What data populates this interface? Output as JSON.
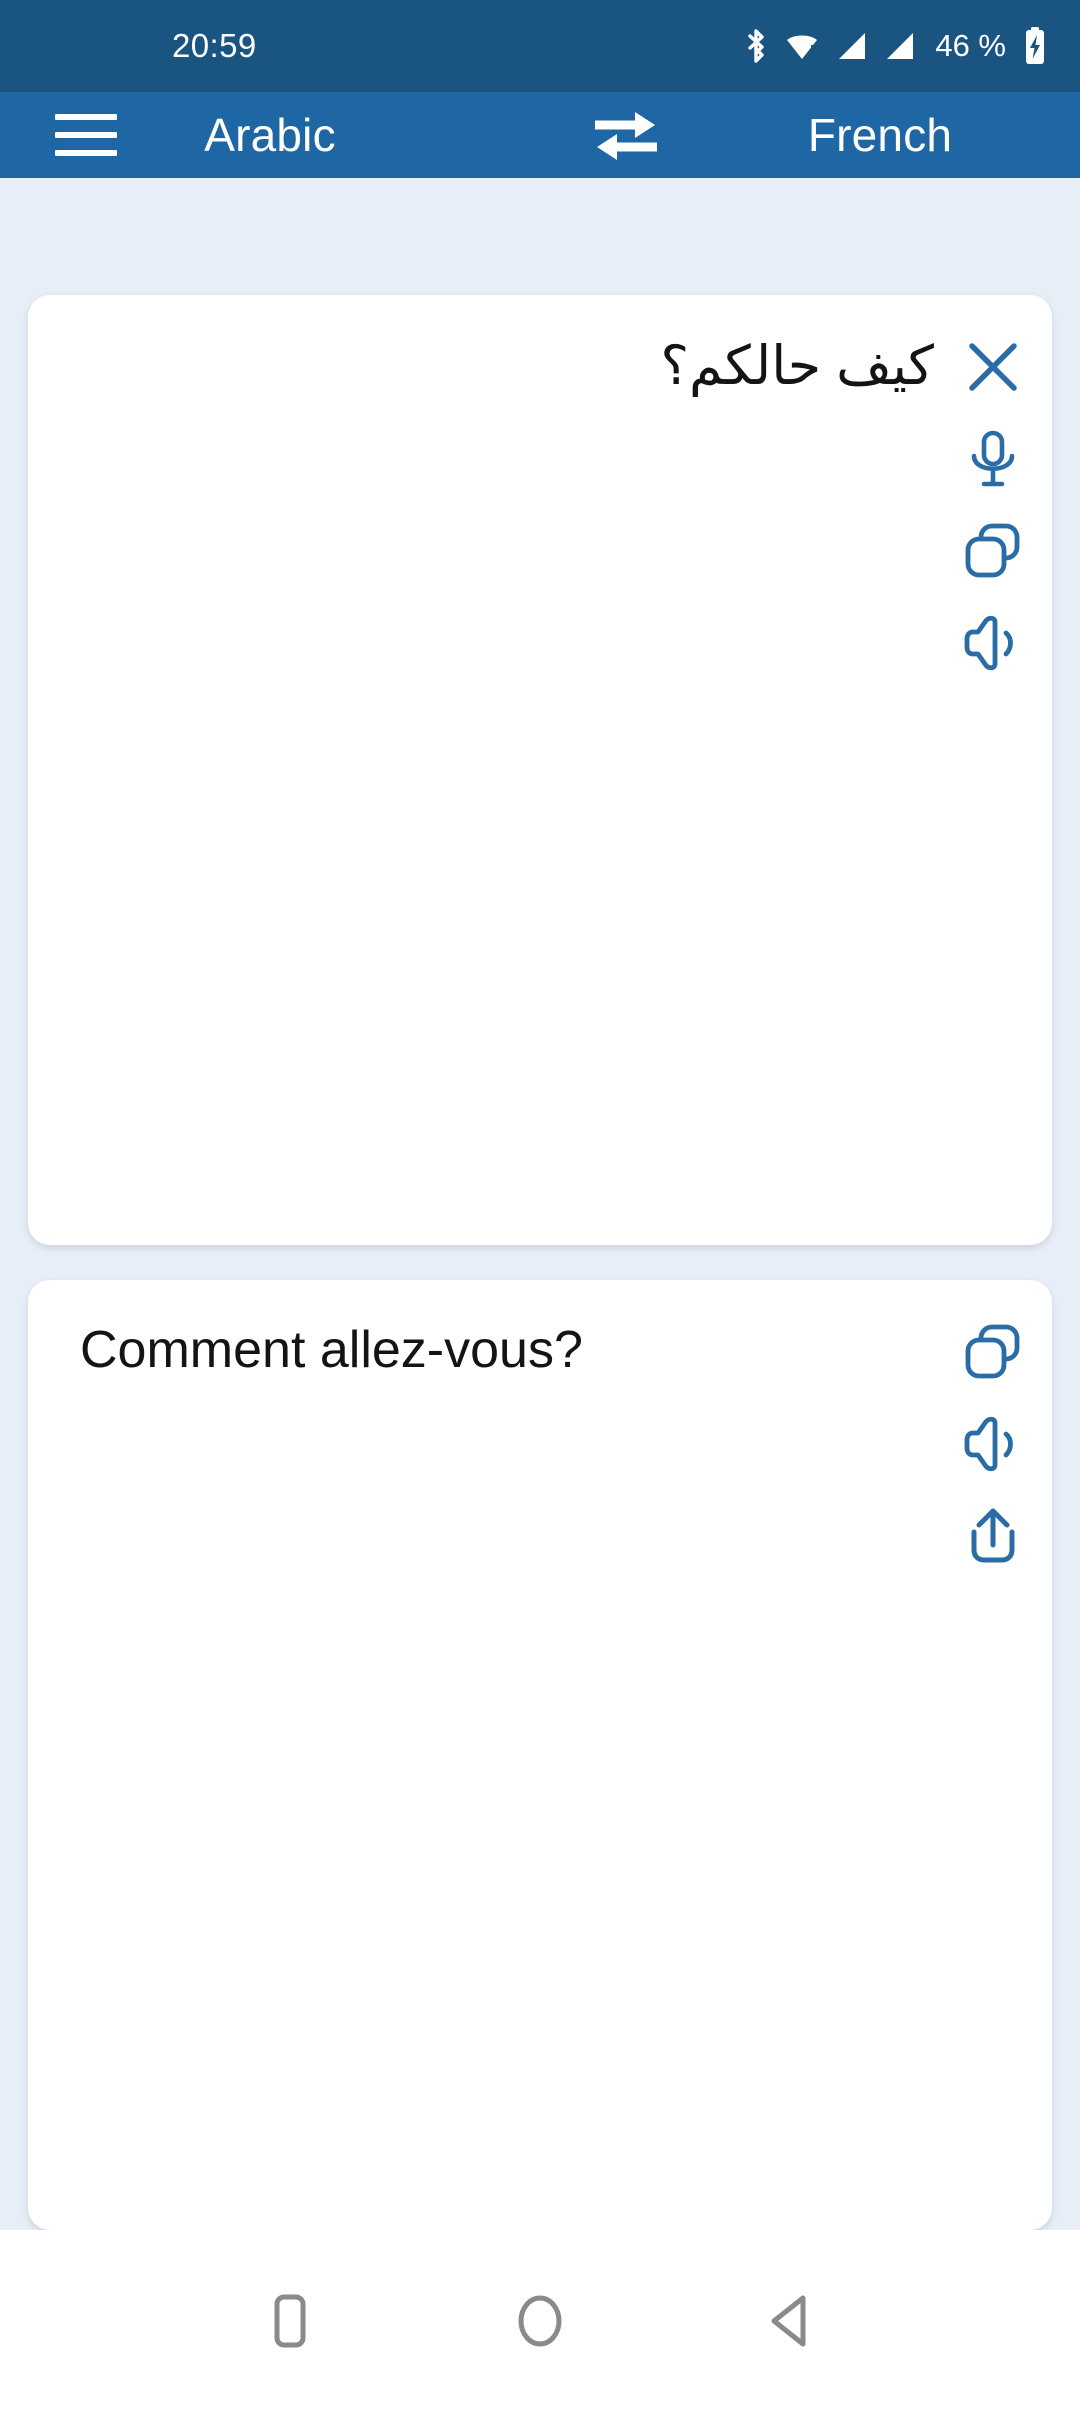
{
  "status_bar": {
    "time": "20:59",
    "battery_percent": "46 %",
    "icons": [
      "bluetooth-icon",
      "wifi-icon",
      "signal-icon-sim1",
      "signal-icon-sim2",
      "battery-charging-icon"
    ],
    "background_color": "#1a5480",
    "foreground_color": "#ffffff"
  },
  "app_bar": {
    "menu_label": "menu-icon",
    "source_language": "Arabic",
    "target_language": "French",
    "swap_label": "swap-languages-icon",
    "background_color": "#1f66a5",
    "text_color": "#ffffff"
  },
  "source_card": {
    "text": "كيف حالكم؟",
    "actions": [
      {
        "name": "clear-button",
        "icon": "close-icon"
      },
      {
        "name": "microphone-button",
        "icon": "microphone-icon"
      },
      {
        "name": "copy-button",
        "icon": "copy-icon"
      },
      {
        "name": "speak-button",
        "icon": "speaker-icon"
      }
    ]
  },
  "target_card": {
    "text": "Comment allez-vous?",
    "actions": [
      {
        "name": "copy-button",
        "icon": "copy-icon"
      },
      {
        "name": "speak-button",
        "icon": "speaker-icon"
      },
      {
        "name": "share-button",
        "icon": "share-icon"
      }
    ]
  },
  "nav_bar": {
    "buttons": [
      "recents-button",
      "home-button",
      "back-button"
    ],
    "icon_color": "#8a8a8a",
    "background_color": "#ffffff"
  },
  "theme": {
    "accent": "#1f66a5",
    "icon_blue": "#2a6da6",
    "page_background": "#e8eef7",
    "card_background": "#ffffff",
    "text_color": "#141414"
  }
}
